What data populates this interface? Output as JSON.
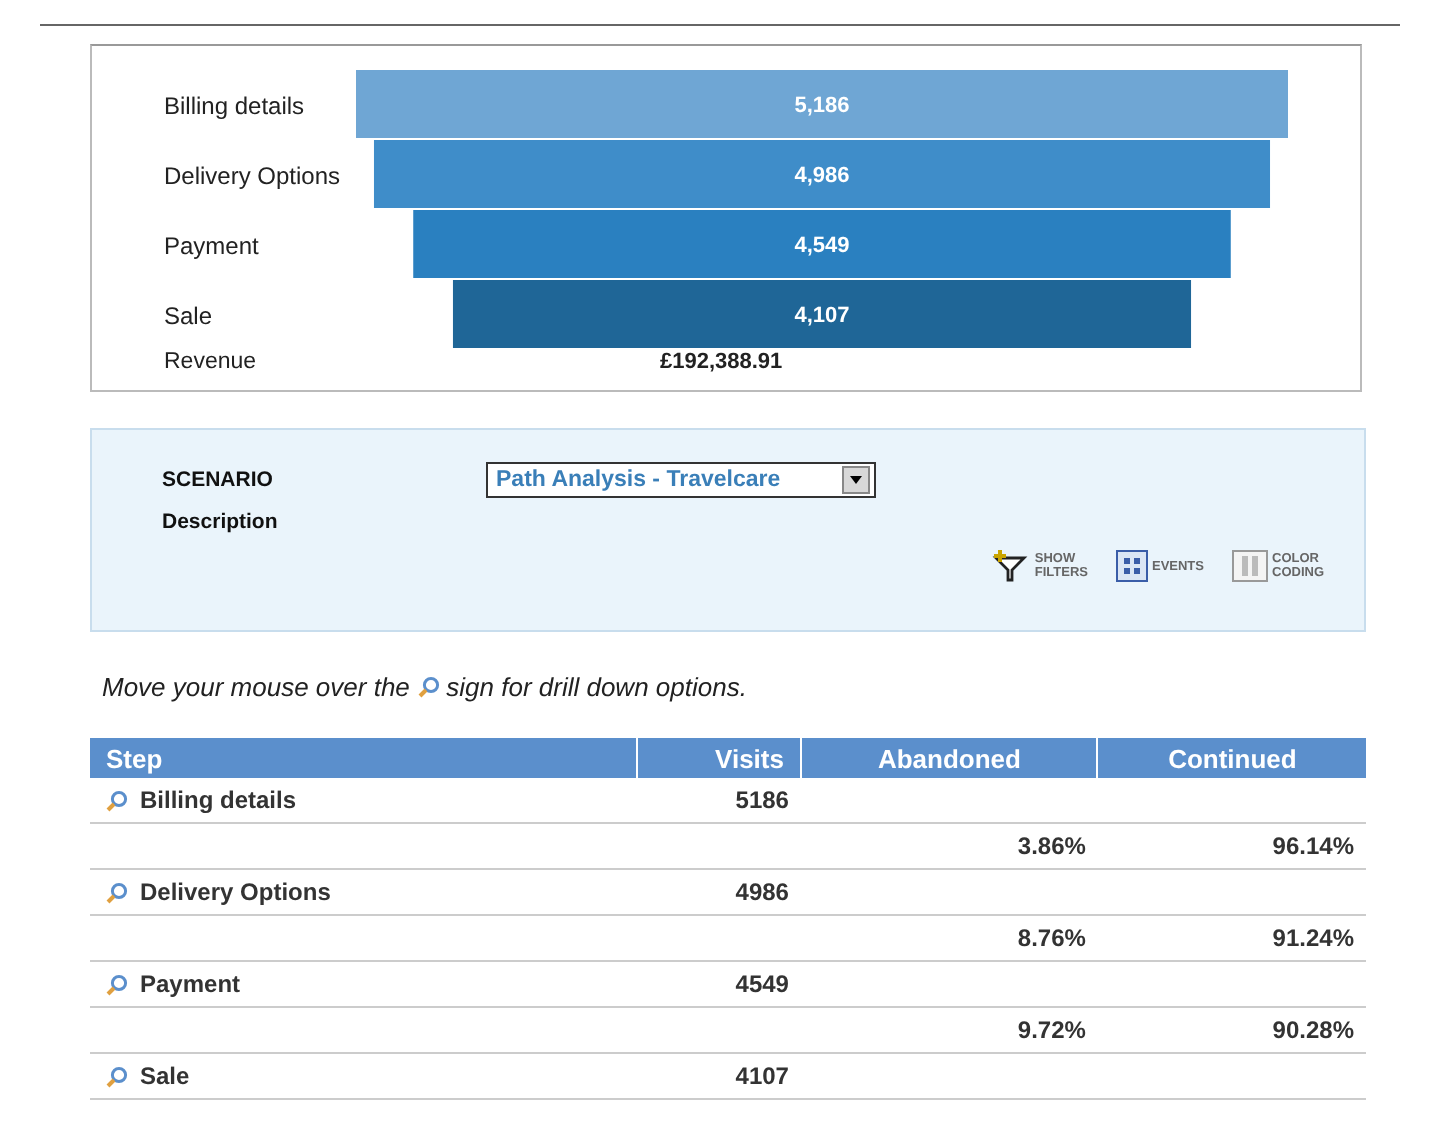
{
  "funnel": {
    "steps": [
      {
        "label": "Billing details",
        "value": "5,186"
      },
      {
        "label": "Delivery Options",
        "value": "4,986"
      },
      {
        "label": "Payment",
        "value": "4,549"
      },
      {
        "label": "Sale",
        "value": "4,107"
      }
    ],
    "revenue": {
      "label": "Revenue",
      "value": "£192,388.91"
    }
  },
  "scenario": {
    "label": "SCENARIO",
    "value": "Path Analysis - Travelcare",
    "description_label": "Description",
    "tools": [
      {
        "kind": "filters",
        "label": [
          "SHOW",
          "FILTERS"
        ]
      },
      {
        "kind": "events",
        "label": [
          "EVENTS"
        ]
      },
      {
        "kind": "color",
        "label": [
          "COLOR",
          "CODING"
        ]
      }
    ]
  },
  "hint": {
    "before": "Move your mouse over the",
    "after": "sign for drill down options."
  },
  "table": {
    "columns": [
      "Step",
      "Visits",
      "Abandoned",
      "Continued"
    ],
    "rows": [
      {
        "kind": "step",
        "step": "Billing details",
        "visits": "5186"
      },
      {
        "kind": "rate",
        "abandoned": "3.86%",
        "continued": "96.14%"
      },
      {
        "kind": "step",
        "step": "Delivery Options",
        "visits": "4986"
      },
      {
        "kind": "rate",
        "abandoned": "8.76%",
        "continued": "91.24%"
      },
      {
        "kind": "step",
        "step": "Payment",
        "visits": "4549"
      },
      {
        "kind": "rate",
        "abandoned": "9.72%",
        "continued": "90.28%"
      },
      {
        "kind": "step",
        "step": "Sale",
        "visits": "4107"
      }
    ]
  }
}
